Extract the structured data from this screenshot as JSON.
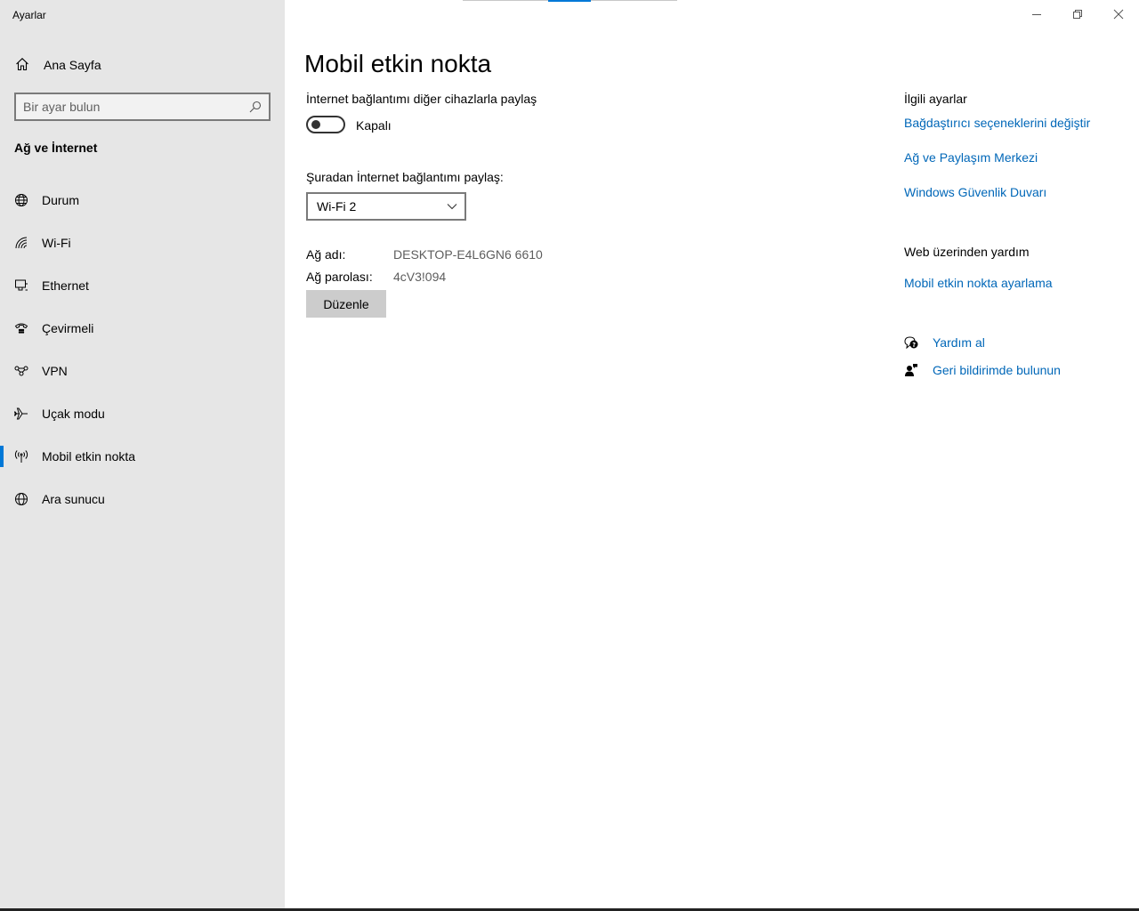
{
  "app": {
    "title": "Ayarlar"
  },
  "sidebar": {
    "home_label": "Ana Sayfa",
    "search_placeholder": "Bir ayar bulun",
    "section_title": "Ağ ve İnternet",
    "items": [
      {
        "label": "Durum",
        "icon": "globe-status-icon"
      },
      {
        "label": "Wi-Fi",
        "icon": "wifi-icon"
      },
      {
        "label": "Ethernet",
        "icon": "ethernet-icon"
      },
      {
        "label": "Çevirmeli",
        "icon": "dialup-icon"
      },
      {
        "label": "VPN",
        "icon": "vpn-icon"
      },
      {
        "label": "Uçak modu",
        "icon": "airplane-icon"
      },
      {
        "label": "Mobil etkin nokta",
        "icon": "hotspot-icon",
        "active": true
      },
      {
        "label": "Ara sunucu",
        "icon": "globe-icon"
      }
    ]
  },
  "main": {
    "title": "Mobil etkin nokta",
    "share_label": "İnternet bağlantımı diğer cihazlarla paylaş",
    "toggle_state": "Kapalı",
    "from_label": "Şuradan İnternet bağlantımı paylaş:",
    "from_value": "Wi-Fi 2",
    "network_name_label": "Ağ adı:",
    "network_name_value": "DESKTOP-E4L6GN6 6610",
    "password_label": "Ağ parolası:",
    "password_value": "4cV3!094",
    "edit_button": "Düzenle"
  },
  "related": {
    "title": "İlgili ayarlar",
    "links": [
      "Bağdaştırıcı seçeneklerini değiştir",
      "Ağ ve Paylaşım Merkezi",
      "Windows Güvenlik Duvarı"
    ]
  },
  "web_help": {
    "title": "Web üzerinden yardım",
    "link": "Mobil etkin nokta ayarlama"
  },
  "help": {
    "get_help": "Yardım al",
    "feedback": "Geri bildirimde bulunun"
  },
  "colors": {
    "accent": "#0078d7",
    "link": "#0067b8",
    "sidebar_bg": "#e6e6e6"
  }
}
